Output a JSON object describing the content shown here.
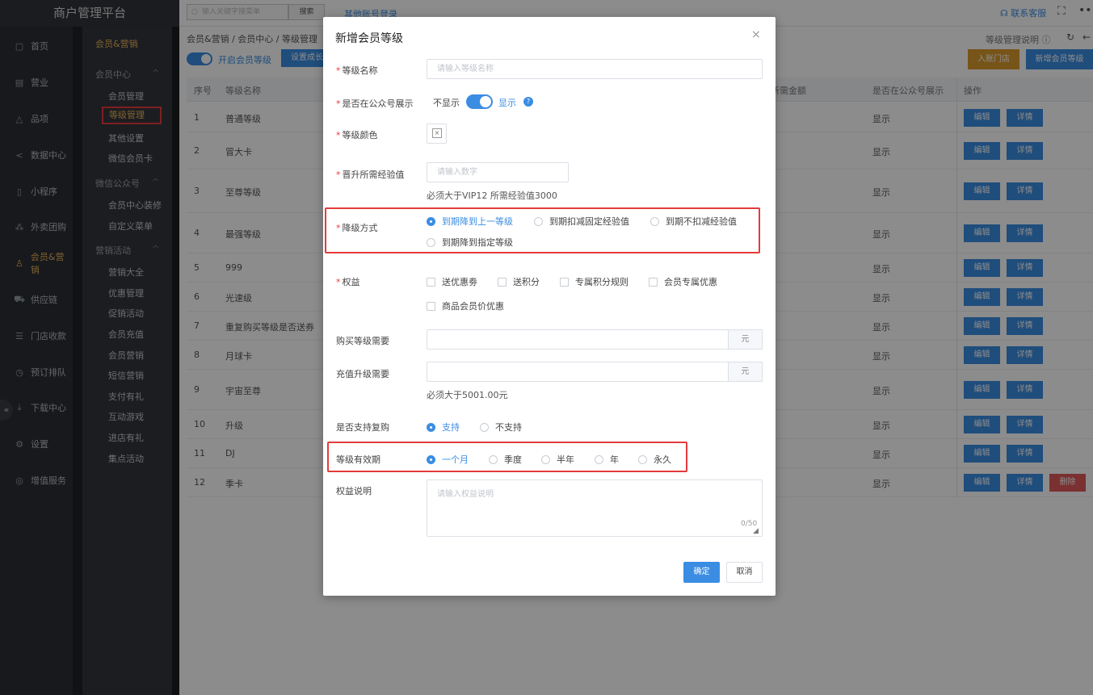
{
  "app": {
    "title": "商户管理平台"
  },
  "nav": {
    "items": [
      {
        "label": "首页",
        "icon": "home-icon",
        "glyph": "▢"
      },
      {
        "label": "营业",
        "icon": "business-icon",
        "glyph": "▤"
      },
      {
        "label": "品项",
        "icon": "bag-icon",
        "glyph": "△"
      },
      {
        "label": "数据中心",
        "icon": "share-icon",
        "glyph": "<"
      },
      {
        "label": "小程序",
        "icon": "mobile-icon",
        "glyph": "▯"
      },
      {
        "label": "外卖团购",
        "icon": "group-icon",
        "glyph": "⁂"
      },
      {
        "label": "会员&营销",
        "icon": "user-icon",
        "glyph": "♙"
      },
      {
        "label": "供应链",
        "icon": "truck-icon",
        "glyph": "⛟"
      },
      {
        "label": "门店收款",
        "icon": "database-icon",
        "glyph": "☰"
      },
      {
        "label": "预订排队",
        "icon": "clock-icon",
        "glyph": "◷"
      },
      {
        "label": "下载中心",
        "icon": "download-icon",
        "glyph": "⤓"
      },
      {
        "label": "设置",
        "icon": "gear-icon",
        "glyph": "⚙"
      },
      {
        "label": "增值服务",
        "icon": "bell-icon",
        "glyph": "◎"
      }
    ]
  },
  "submenu": {
    "title": "会员&营销",
    "groups": [
      {
        "label": "会员中心",
        "items": [
          "会员管理",
          "等级管理",
          "其他设置",
          "微信会员卡"
        ]
      },
      {
        "label": "微信公众号",
        "items": [
          "会员中心装修",
          "自定义菜单"
        ]
      },
      {
        "label": "营销活动",
        "items": [
          "营销大全",
          "优惠管理",
          "促销活动",
          "会员充值",
          "会员营销",
          "短信营销",
          "支付有礼",
          "互动游戏",
          "进店有礼",
          "集点活动"
        ]
      }
    ]
  },
  "topbar": {
    "search_placeholder": "输入关键字搜菜单",
    "search_btn": "搜索",
    "other_login": "其他账号登录",
    "service": "联系客服",
    "collapse": "«",
    "fullscreen": "⛶",
    "more": "•••"
  },
  "page": {
    "breadcrumb": "会员&营销 / 会员中心 / 等级管理",
    "help": "等级管理说明 ⓘ",
    "refresh": "↻",
    "back": "←",
    "toggle_label": "开启会员等级",
    "btn_setgrow": "设置成长值",
    "btn_store": "入账门店",
    "btn_new": "新增会员等级"
  },
  "table": {
    "headers": {
      "no": "序号",
      "name": "等级名称",
      "amount": "升级所需金额",
      "show": "是否在公众号展示",
      "ops": "操作"
    },
    "rows": [
      {
        "no": "1",
        "name": "普通等级",
        "show": "显示"
      },
      {
        "no": "2",
        "name": "冒大卡",
        "show": "显示"
      },
      {
        "no": "3",
        "name": "至尊等级",
        "show": "显示"
      },
      {
        "no": "4",
        "name": "最强等级",
        "show": "显示"
      },
      {
        "no": "5",
        "name": "999",
        "show": "显示"
      },
      {
        "no": "6",
        "name": "光速级",
        "show": "显示"
      },
      {
        "no": "7",
        "name": "重复购买等级是否送券",
        "show": "显示"
      },
      {
        "no": "8",
        "name": "月球卡",
        "show": "显示"
      },
      {
        "no": "9",
        "name": "宇宙至尊",
        "show": "显示"
      },
      {
        "no": "10",
        "name": "升级",
        "show": "显示"
      },
      {
        "no": "11",
        "name": "DJ",
        "show": "显示"
      },
      {
        "no": "12",
        "name": "季卡",
        "show": "显示"
      }
    ],
    "edit": "编辑",
    "detail": "详情",
    "delete": "删除"
  },
  "modal": {
    "title": "新增会员等级",
    "close": "×",
    "name_label": "等级名称",
    "name_placeholder": "请输入等级名称",
    "show_label": "是否在公众号展示",
    "show_off": "不显示",
    "show_on": "显示",
    "help": "?",
    "color_label": "等级颜色",
    "color_empty": "×",
    "exp_label": "晋升所需经验值",
    "exp_placeholder": "请输入数字",
    "exp_hint": "必须大于VIP12 所需经验值3000",
    "down_label": "降级方式",
    "down_options": [
      "到期降到上一等级",
      "到期扣减固定经验值",
      "到期不扣减经验值",
      "到期降到指定等级"
    ],
    "rights_label": "权益",
    "rights_options": [
      "送优惠劵",
      "送积分",
      "专属积分规则",
      "会员专属优惠",
      "商品会员价优惠"
    ],
    "buy_label": "购买等级需要",
    "buy_unit": "元",
    "recharge_label": "充值升级需要",
    "recharge_unit": "元",
    "recharge_hint": "必须大于5001.00元",
    "rebuy_label": "是否支持复购",
    "rebuy_options": [
      "支持",
      "不支持"
    ],
    "valid_label": "等级有效期",
    "valid_options": [
      "一个月",
      "季度",
      "半年",
      "年",
      "永久"
    ],
    "desc_label": "权益说明",
    "desc_placeholder": "请输入权益说明",
    "desc_counter": "0/50",
    "ok": "确定",
    "cancel": "取消"
  }
}
